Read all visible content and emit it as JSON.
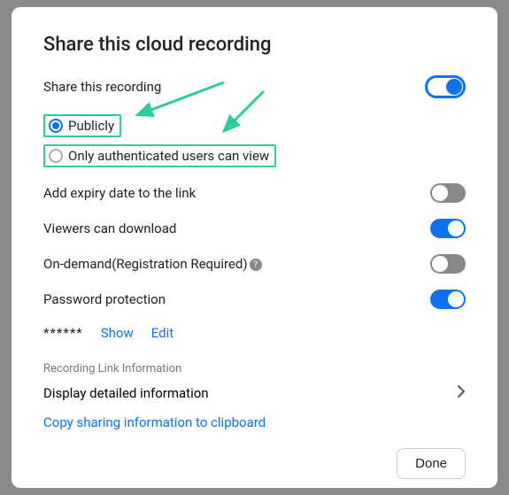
{
  "title": "Share this cloud recording",
  "share_label": "Share this recording",
  "radio_publicly": "Publicly",
  "radio_authenticated": "Only authenticated users can view",
  "add_expiry": "Add expiry date to the link",
  "viewers_download": "Viewers can download",
  "on_demand": "On-demand(Registration Required)",
  "password_protection": "Password protection",
  "password_value": "******",
  "show": "Show",
  "edit": "Edit",
  "recording_link_info": "Recording Link Information",
  "display_detailed": "Display detailed information",
  "copy_sharing": "Copy sharing information to clipboard",
  "done": "Done",
  "toggles": {
    "share": true,
    "expiry": false,
    "download": true,
    "on_demand": false,
    "password": true
  }
}
